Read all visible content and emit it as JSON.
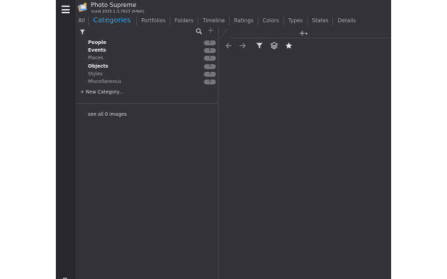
{
  "app": {
    "title": "Photo Supreme",
    "build": "build 2025.1.3.7623 (64bit)"
  },
  "tabs": [
    {
      "label": "All"
    },
    {
      "label": "Categories",
      "active": true
    },
    {
      "label": "Portfolios"
    },
    {
      "label": "Folders"
    },
    {
      "label": "Timeline"
    },
    {
      "label": "Ratings"
    },
    {
      "label": "Colors"
    },
    {
      "label": "Types"
    },
    {
      "label": "States"
    },
    {
      "label": "Details"
    }
  ],
  "categories": [
    {
      "label": "People",
      "count": "0"
    },
    {
      "label": "Events",
      "count": "0"
    },
    {
      "label": "Places",
      "count": "0"
    },
    {
      "label": "Objects",
      "count": "0"
    },
    {
      "label": "Styles",
      "count": "0"
    },
    {
      "label": "Miscellaneous",
      "count": "0"
    }
  ],
  "left_panel": {
    "new_category": "+ New Category...",
    "see_all": "see all 0 images",
    "add_symbol": "+"
  },
  "right_panel": {
    "add_symbol": "+"
  },
  "icons": {
    "menu": "hamburger-icon",
    "filter": "filter-icon",
    "search": "search-icon",
    "back": "arrow-left-icon",
    "forward": "arrow-right-icon",
    "layers": "layers-icon",
    "favorite": "star-icon"
  },
  "colors": {
    "background": "#333237",
    "rail": "#28272c",
    "accent": "#35a3e8"
  }
}
